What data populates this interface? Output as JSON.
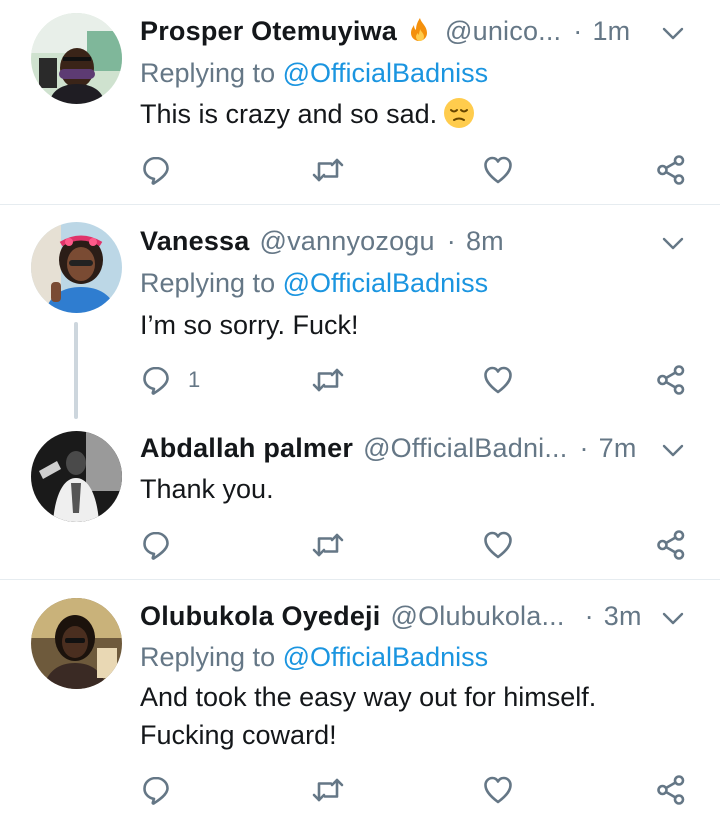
{
  "replying_prefix": "Replying to",
  "tweets": [
    {
      "name": "Prosper Otemuyiwa",
      "handle": "@unico...",
      "time": "1m",
      "replying_to": "@OfficialBadniss",
      "text": "This is crazy and so sad.",
      "reply_count": ""
    },
    {
      "name": "Vanessa",
      "handle": "@vannyozogu",
      "time": "8m",
      "replying_to": "@OfficialBadniss",
      "text": "I’m so sorry. Fuck!",
      "reply_count": "1"
    },
    {
      "name": "Abdallah palmer",
      "handle": "@OfficialBadni...",
      "time": "7m",
      "replying_to": "",
      "text": "Thank you.",
      "reply_count": ""
    },
    {
      "name": "Olubukola Oyedeji",
      "handle": "@Olubukola...",
      "time": "3m",
      "replying_to": "@OfficialBadniss",
      "text_line1": "And took the easy way out for himself.",
      "text_line2": "Fucking coward!",
      "reply_count": ""
    }
  ],
  "icons": {
    "menu": "chevron-down-icon",
    "reply": "reply-icon",
    "retweet": "retweet-icon",
    "like": "heart-icon",
    "share": "share-icon",
    "fire_emoji": "fire-emoji-icon",
    "sad_emoji": "disappointed-face-emoji-icon"
  },
  "colors": {
    "text": "#14171a",
    "secondary": "#657786",
    "mention": "#1b95e0",
    "divider": "#e6ecf0",
    "thread_line": "#cdd6dd"
  }
}
